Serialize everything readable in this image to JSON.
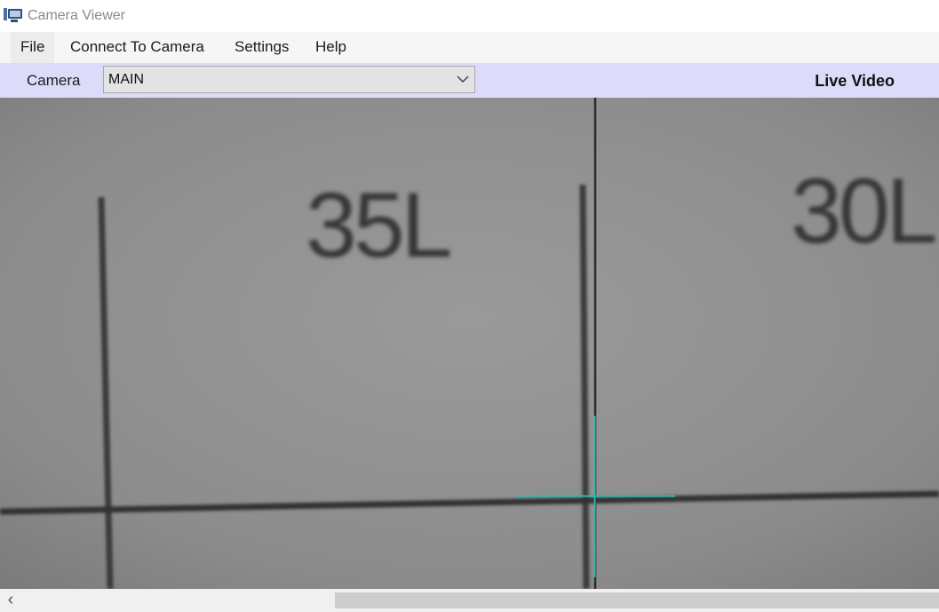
{
  "window": {
    "title": "Camera Viewer",
    "icon": "camera-viewer-app-icon"
  },
  "menu": {
    "items": [
      "File",
      "Connect To Camera",
      "Settings",
      "Help"
    ]
  },
  "toolbar": {
    "camera_label": "Camera",
    "camera_selected": "MAIN",
    "status": "Live Video",
    "background_color": "#dcdcfa"
  },
  "video": {
    "labels": [
      "35L",
      "30L"
    ],
    "crosshair_color": "#2fb8b8"
  },
  "scrollbar": {
    "left_arrow": "‹"
  }
}
